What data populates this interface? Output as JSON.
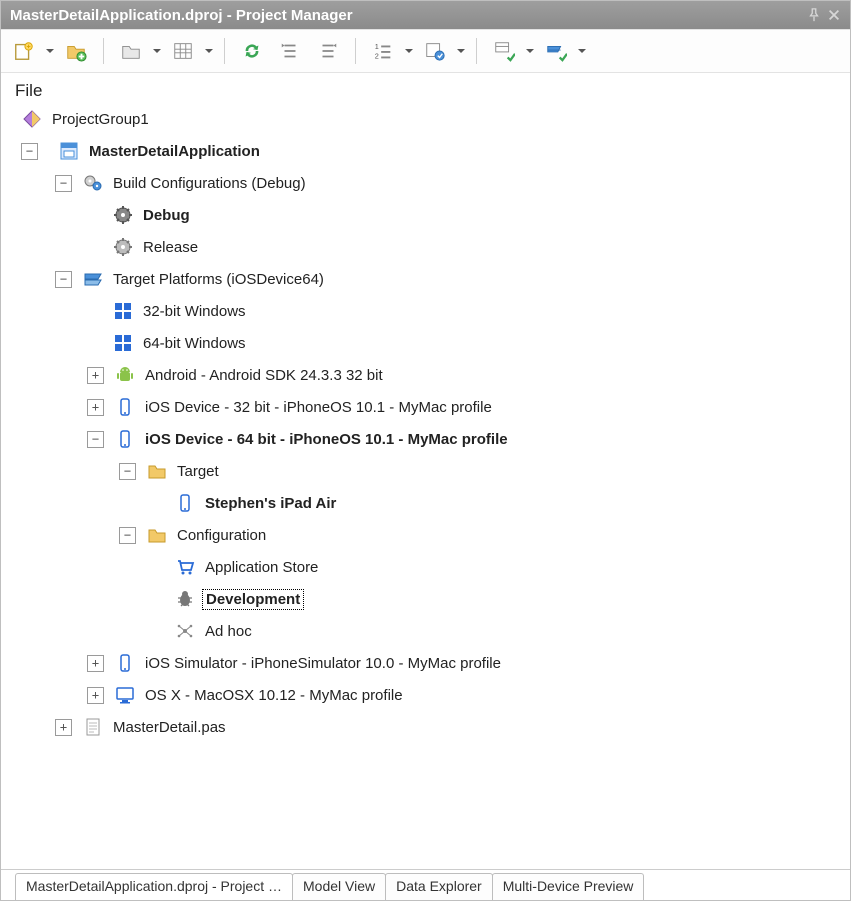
{
  "window": {
    "title": "MasterDetailApplication.dproj - Project Manager"
  },
  "toolbar": {
    "new": "New",
    "add": "Add",
    "open": "Open",
    "grid": "View",
    "refresh": "Sync",
    "collapse": "Collapse",
    "expand": "Expand",
    "sort": "Sort",
    "views": "Views",
    "build1": "Build Groups",
    "build2": "Build"
  },
  "tree": {
    "file_header": "File",
    "project_group": "ProjectGroup1",
    "project": "MasterDetailApplication",
    "build_cfg": "Build Configurations (Debug)",
    "debug": "Debug",
    "release": "Release",
    "target_platforms": "Target Platforms (iOSDevice64)",
    "win32": "32-bit Windows",
    "win64": "64-bit Windows",
    "android": "Android - Android SDK 24.3.3 32 bit",
    "ios32": "iOS Device - 32 bit - iPhoneOS 10.1 - MyMac profile",
    "ios64": "iOS Device - 64 bit - iPhoneOS 10.1 - MyMac profile",
    "target_folder": "Target",
    "ipad": "Stephen's iPad Air",
    "config_folder": "Configuration",
    "appstore": "Application Store",
    "development": "Development",
    "adhoc": "Ad hoc",
    "simulator": "iOS Simulator - iPhoneSimulator 10.0 - MyMac profile",
    "osx": "OS X - MacOSX 10.12 - MyMac profile",
    "unit": "MasterDetail.pas"
  },
  "tabs": {
    "t1": "MasterDetailApplication.dproj - Project …",
    "t2": "Model View",
    "t3": "Data Explorer",
    "t4": "Multi-Device Preview"
  }
}
